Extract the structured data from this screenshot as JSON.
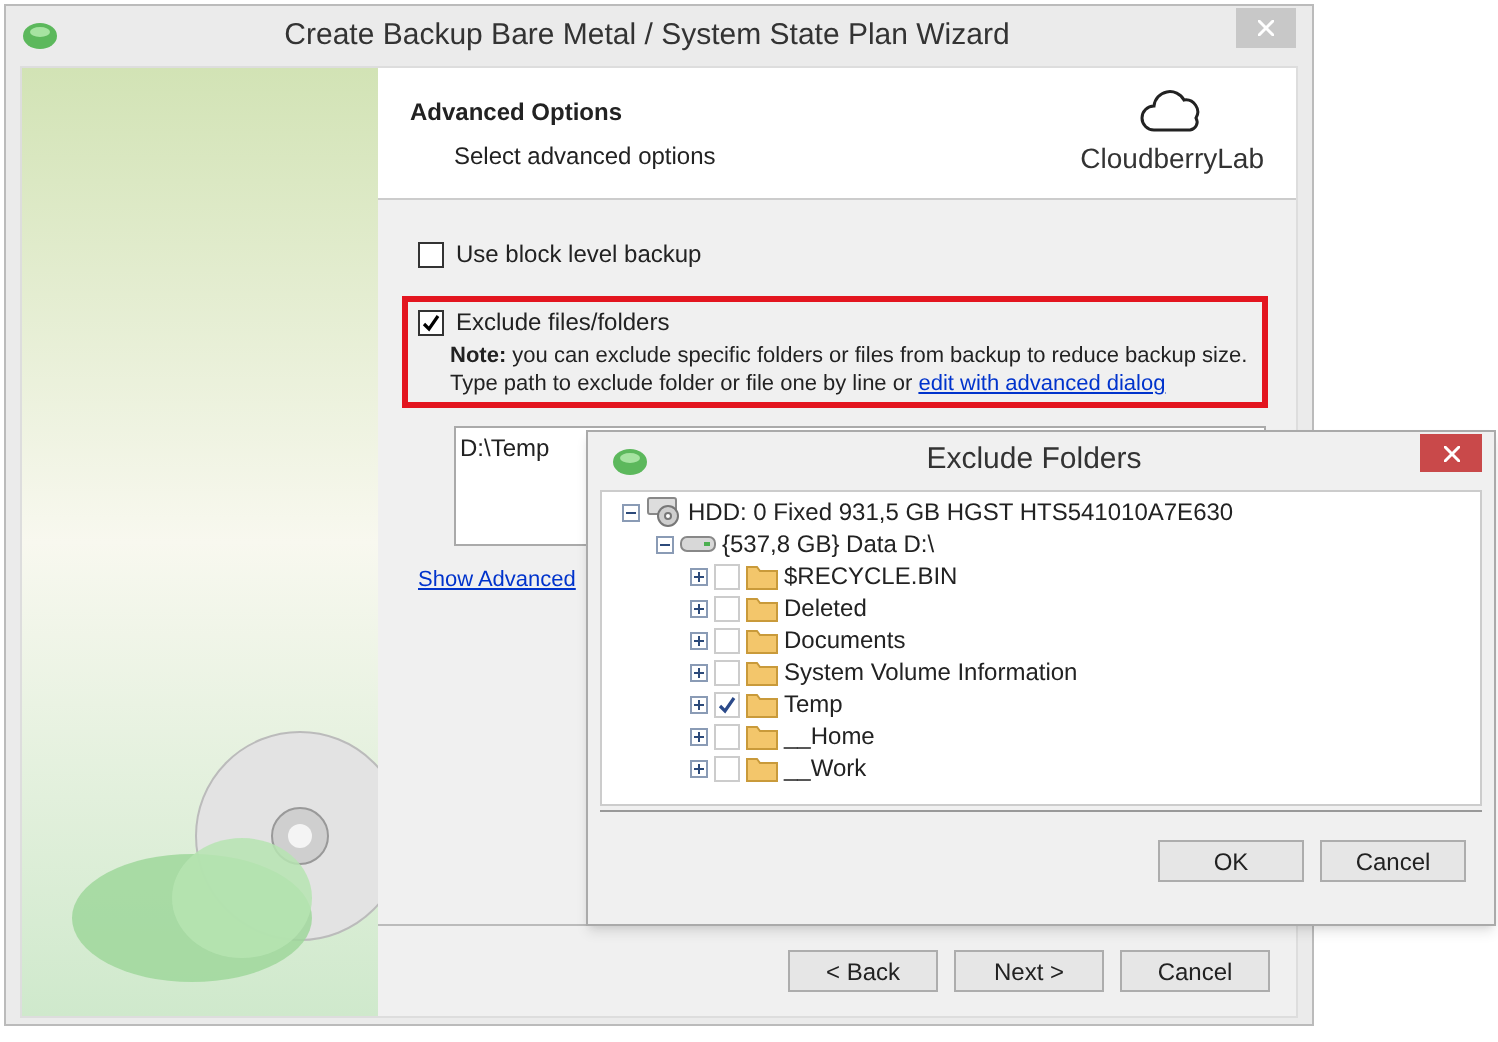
{
  "window": {
    "title": "Create Backup Bare Metal / System State Plan Wizard"
  },
  "header": {
    "title": "Advanced Options",
    "subtitle": "Select advanced options",
    "logo_text": "CloudberryLab"
  },
  "options": [
    {
      "label": "Use block level backup",
      "checked": false
    },
    {
      "label": "Exclude files/folders",
      "checked": true,
      "highlighted": true
    }
  ],
  "note": {
    "label": "Note:",
    "text": "you can exclude specific folders or files from backup to reduce backup size. Type path to exclude folder or file one by line or",
    "link": "edit with advanced dialog"
  },
  "exclude_list": {
    "value": "D:\\Temp"
  },
  "show_advanced_link": "Show Advanced",
  "buttons": [
    {
      "label": "< Back"
    },
    {
      "label": "Next >"
    },
    {
      "label": "Cancel"
    }
  ],
  "dialog": {
    "title": "Exclude Folders",
    "tree": [
      {
        "label": "HDD: 0 Fixed 931,5 GB HGST HTS541010A7E630",
        "kind": "disk",
        "expanded": true,
        "children": [
          {
            "label": "{537,8 GB} Data D:\\",
            "kind": "drive",
            "expanded": true,
            "children": [
              {
                "label": "$RECYCLE.BIN",
                "kind": "folder",
                "expanded": false,
                "checked": false
              },
              {
                "label": "Deleted",
                "kind": "folder",
                "expanded": false,
                "checked": false
              },
              {
                "label": "Documents",
                "kind": "folder",
                "expanded": false,
                "checked": false
              },
              {
                "label": "System Volume Information",
                "kind": "folder",
                "expanded": false,
                "checked": false
              },
              {
                "label": "Temp",
                "kind": "folder",
                "expanded": false,
                "checked": true
              },
              {
                "label": "__Home",
                "kind": "folder",
                "expanded": false,
                "checked": false
              },
              {
                "label": "__Work",
                "kind": "folder",
                "expanded": false,
                "checked": false
              }
            ]
          }
        ]
      }
    ],
    "buttons": [
      {
        "label": "OK"
      },
      {
        "label": "Cancel"
      }
    ]
  }
}
